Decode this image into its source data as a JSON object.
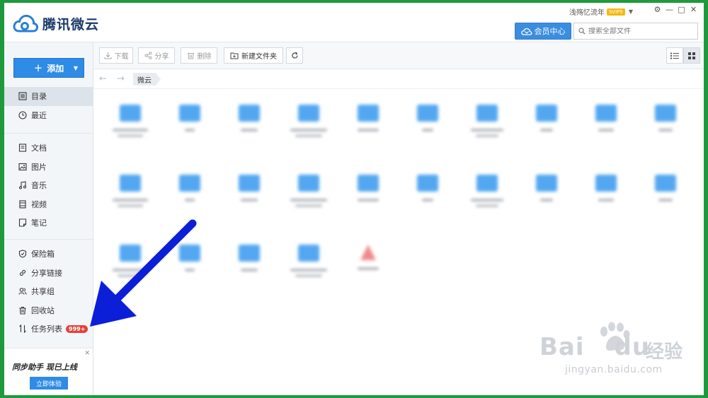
{
  "app": {
    "title": "腾讯微云",
    "username": "浅殇忆流年",
    "svip_badge": "SVIP5",
    "vip_button": "会员中心",
    "search_placeholder": "搜索全部文件"
  },
  "sidebar": {
    "add_label": "添加",
    "group1": [
      {
        "label": "目录",
        "icon": "directory-icon",
        "active": true
      },
      {
        "label": "最近",
        "icon": "clock-icon"
      }
    ],
    "group2": [
      {
        "label": "文档",
        "icon": "document-icon"
      },
      {
        "label": "图片",
        "icon": "image-icon"
      },
      {
        "label": "音乐",
        "icon": "music-icon"
      },
      {
        "label": "视频",
        "icon": "video-icon"
      },
      {
        "label": "笔记",
        "icon": "note-icon"
      }
    ],
    "group3": [
      {
        "label": "保险箱",
        "icon": "shield-icon"
      },
      {
        "label": "分享链接",
        "icon": "link-icon"
      },
      {
        "label": "共享组",
        "icon": "group-icon"
      },
      {
        "label": "回收站",
        "icon": "trash-icon"
      },
      {
        "label": "任务列表",
        "icon": "transfer-icon",
        "badge": "999+"
      }
    ],
    "promo": {
      "title": "同步助手 现已上线",
      "button": "立即体验"
    }
  },
  "toolbar": {
    "download": "下载",
    "share": "分享",
    "delete": "删除",
    "new_folder": "新建文件夹"
  },
  "breadcrumb": {
    "root": "微云"
  },
  "files": {
    "folders_count": 24,
    "pdf_count": 1
  },
  "watermark": {
    "brand": "Bai",
    "brand_tail": "du",
    "cn": "经验",
    "url": "jingyan.baidu.com"
  },
  "colors": {
    "accent": "#2e8be6",
    "badge": "#e4423b",
    "arrow": "#0b1fd9",
    "frame": "#1e9a3c"
  }
}
